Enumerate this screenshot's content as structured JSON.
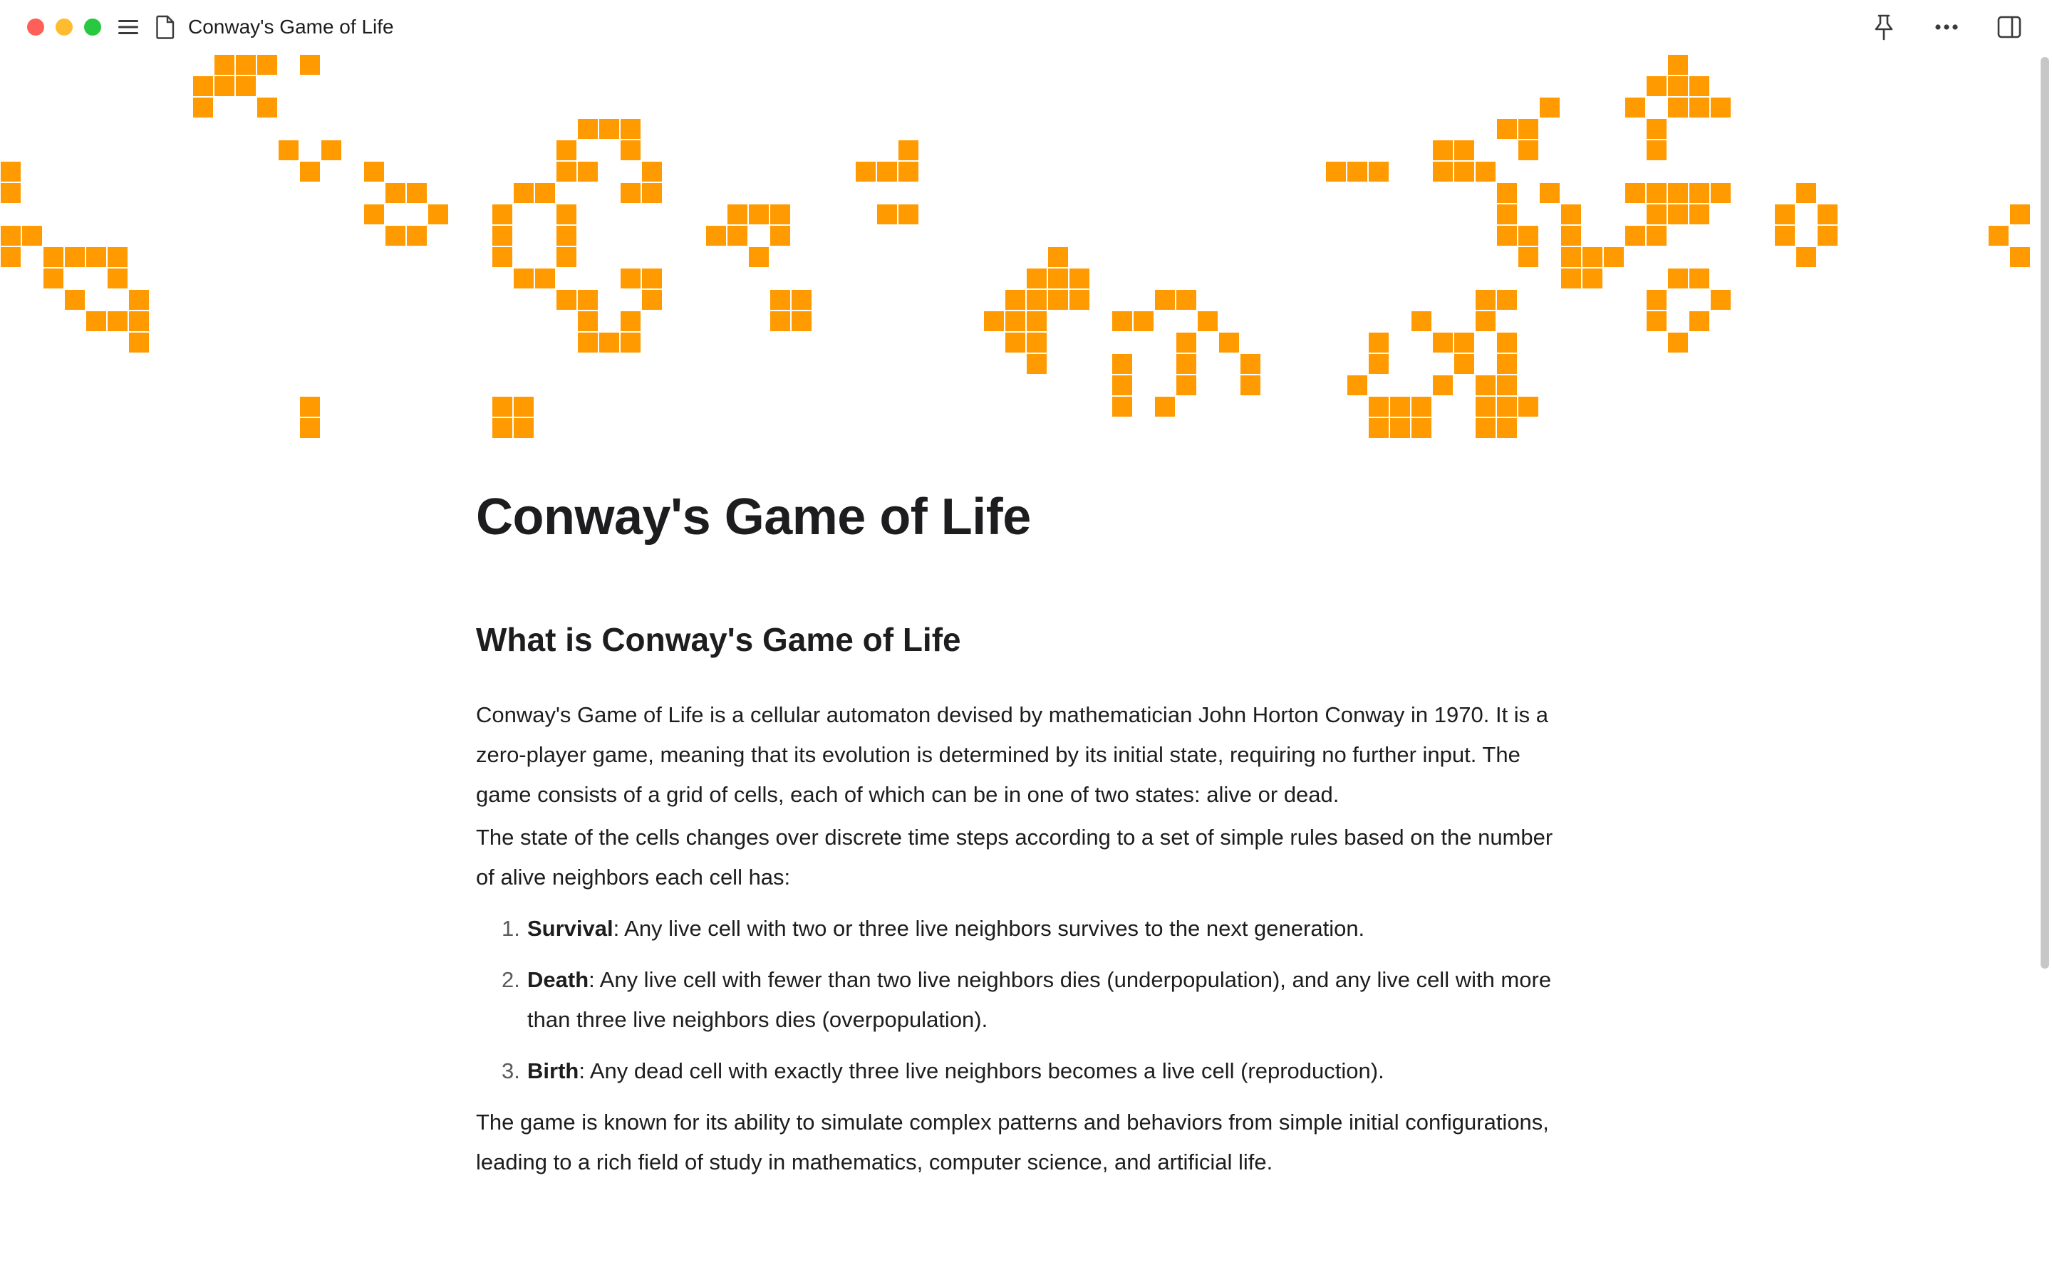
{
  "window": {
    "title": "Conway's Game of Life",
    "icons": {
      "menu": "hamburger-menu-icon",
      "document": "document-icon",
      "pin": "pin-icon",
      "more": "more-options-icon",
      "sidebar": "sidebar-toggle-icon"
    },
    "traffic_lights": [
      "#ff5f57",
      "#febc2e",
      "#28c840"
    ]
  },
  "banner": {
    "cell_color": "#ff9a00",
    "pattern": [
      "...........####..#.............................................................................#...",
      ".........###...............................................................................###..",
      ".........#..#...........................###...........#...............................#..#.#..",
      "............................................................................................",
      "..........................................................................................."
    ]
  },
  "document": {
    "title": "Conway's Game of Life",
    "heading": "What is Conway's Game of Life",
    "paragraph_1": "Conway's Game of Life is a cellular automaton devised by mathematician John Horton Conway in 1970. It is a zero-player game, meaning that its evolution is determined by its initial state, requiring no further input. The game consists of a grid of cells, each of which can be in one of two states: alive or dead.",
    "paragraph_2": "The state of the cells changes over discrete time steps according to a set of simple rules based on the number of alive neighbors each cell has:",
    "rules": [
      {
        "number": "1.",
        "term": "Survival",
        "text": ": Any live cell with two or three live neighbors survives to the next generation."
      },
      {
        "number": "2.",
        "term": "Death",
        "text": ": Any live cell with fewer than two live neighbors dies (underpopulation), and any live cell with more than three live neighbors dies (overpopulation)."
      },
      {
        "number": "3.",
        "term": "Birth",
        "text": ": Any dead cell with exactly three live neighbors becomes a live cell (reproduction)."
      }
    ],
    "paragraph_3": "The game is known for its ability to simulate complex patterns and behaviors from simple initial configurations, leading to a rich field of study in mathematics, computer science, and artificial life."
  }
}
